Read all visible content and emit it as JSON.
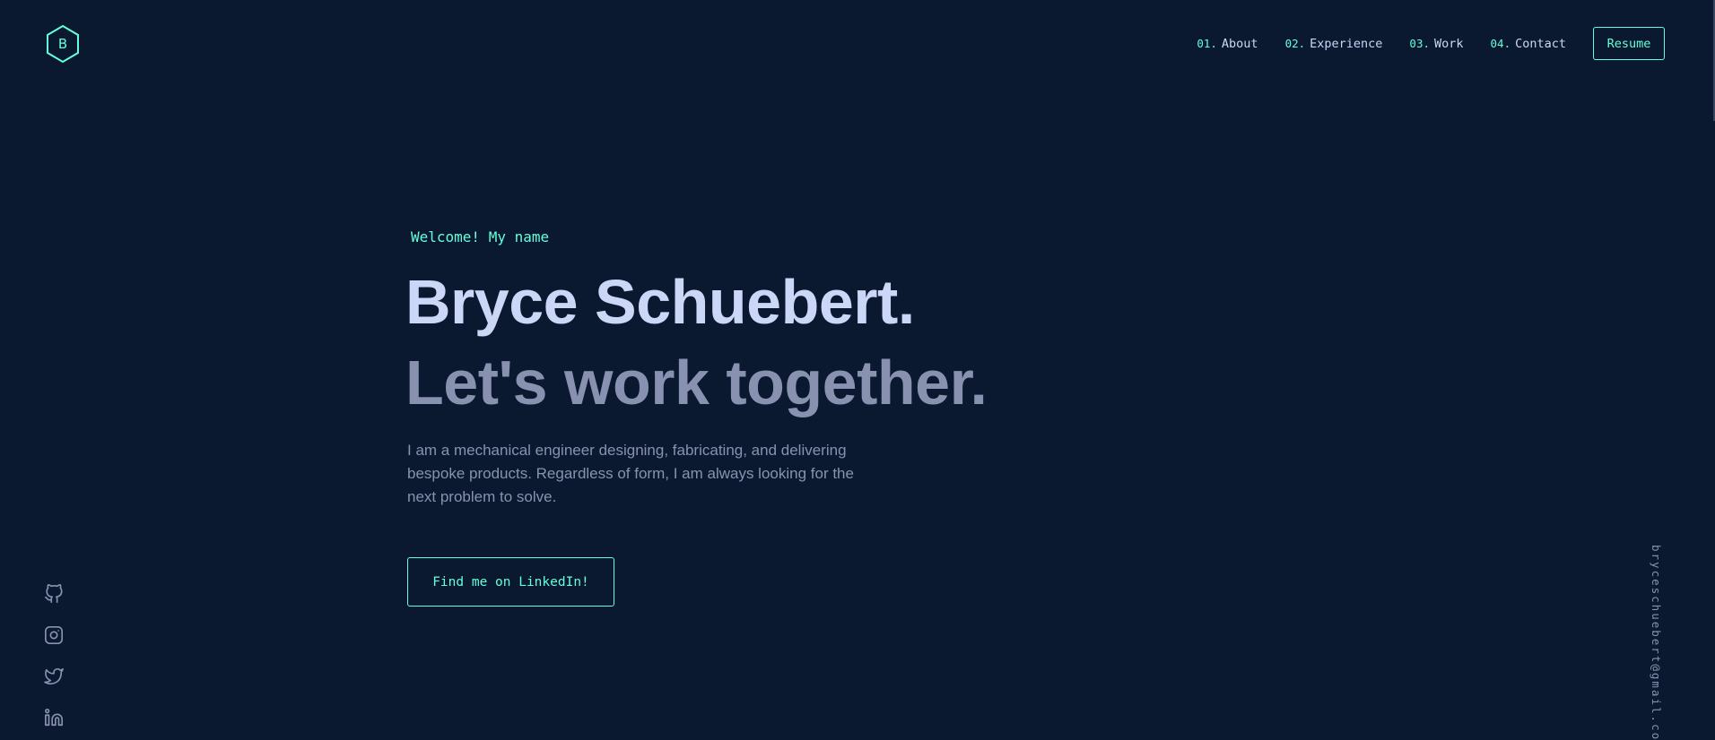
{
  "header": {
    "logo_letter": "B",
    "nav": [
      {
        "num": "01.",
        "label": "About"
      },
      {
        "num": "02.",
        "label": "Experience"
      },
      {
        "num": "03.",
        "label": "Work"
      },
      {
        "num": "04.",
        "label": "Contact"
      }
    ],
    "resume_label": "Resume"
  },
  "hero": {
    "greeting": "Welcome! My name",
    "name": "Bryce Schuebert.",
    "tagline": "Let's work together.",
    "description": "I am a mechanical engineer designing, fabricating, and delivering bespoke products. Regardless of form, I am always looking for the next problem to solve.",
    "cta_label": "Find me on LinkedIn!"
  },
  "social": {
    "icons": [
      "github-icon",
      "instagram-icon",
      "twitter-icon",
      "linkedin-icon"
    ]
  },
  "email": "bryceschuebert@gmail.com",
  "colors": {
    "background": "#0b1930",
    "accent": "#64ffda",
    "heading": "#ccd6f6",
    "body": "#8892b0"
  }
}
